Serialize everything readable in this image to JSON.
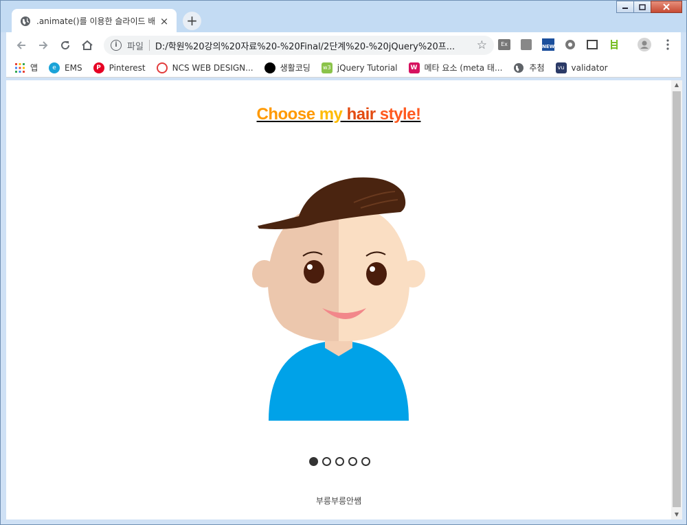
{
  "browser": {
    "tab_title": ".animate()를 이용한 슬라이드 배",
    "tab_close": "×",
    "new_tab": "+",
    "omnibox": {
      "scheme": "파일",
      "url": "D:/학원%20강의%20자료%20-%20Final/2단계%20-%20jQuery%20프..."
    },
    "bookmarks": [
      {
        "label": "앱",
        "icon": "apps-grid-icon"
      },
      {
        "label": "EMS",
        "icon": "ems-icon"
      },
      {
        "label": "Pinterest",
        "icon": "pinterest-icon"
      },
      {
        "label": "NCS WEB DESIGN...",
        "icon": "ncs-icon"
      },
      {
        "label": "생활코딩",
        "icon": "opentutorials-icon"
      },
      {
        "label": "jQuery Tutorial",
        "icon": "w3schools-icon"
      },
      {
        "label": "메타 요소 (meta 태...",
        "icon": "w-icon"
      },
      {
        "label": "추첨",
        "icon": "globe-icon"
      },
      {
        "label": "validator",
        "icon": "validator-icon"
      }
    ]
  },
  "page": {
    "headline": {
      "word1": "Choose",
      "word2": " my ",
      "word3": "hair",
      "word4": " style!"
    },
    "slides_total": 5,
    "active_slide": 1,
    "footer": "부릉부릉안쌤"
  },
  "colors": {
    "hair": "#4a2410",
    "skin_shadow": "#ecc7ad",
    "skin_light": "#fadec3",
    "shirt": "#00a2e8",
    "mouth": "#f2878a"
  }
}
